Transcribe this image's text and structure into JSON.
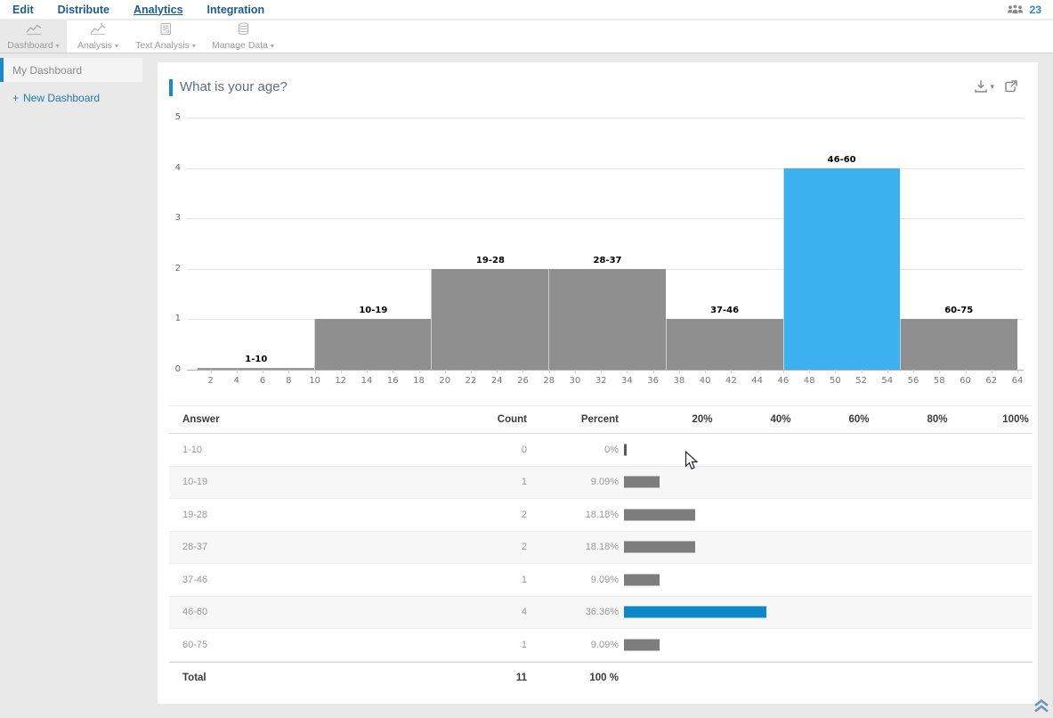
{
  "nav": {
    "items": [
      "Edit",
      "Distribute",
      "Analytics",
      "Integration"
    ],
    "active": "Analytics",
    "user_count": "23"
  },
  "toolbar": {
    "buttons": [
      {
        "label": "Dashboard",
        "icon": "dashboard-chart"
      },
      {
        "label": "Analysis",
        "icon": "analysis-chart"
      },
      {
        "label": "Text Analysis",
        "icon": "text-document"
      },
      {
        "label": "Manage Data",
        "icon": "database"
      }
    ],
    "active": "Dashboard",
    "caret": "▾"
  },
  "sidebar": {
    "active_item": "My Dashboard",
    "plus": "+",
    "new_item": "New Dashboard"
  },
  "panel": {
    "title": "What is your age?"
  },
  "chart_data": {
    "type": "histogram",
    "title": "What is your age?",
    "categories": [
      "1-10",
      "10-19",
      "19-28",
      "28-37",
      "37-46",
      "46-60",
      "60-75"
    ],
    "values": [
      0,
      1,
      2,
      2,
      1,
      4,
      1
    ],
    "highlight_index": 5,
    "ylim": [
      0,
      5
    ],
    "y_ticks": [
      0,
      1,
      2,
      3,
      4,
      5
    ],
    "x_ticks": [
      2,
      4,
      6,
      8,
      10,
      12,
      14,
      16,
      18,
      20,
      22,
      24,
      26,
      28,
      30,
      32,
      34,
      36,
      38,
      40,
      42,
      44,
      46,
      48,
      50,
      52,
      54,
      56,
      58,
      60,
      62,
      64
    ],
    "grid": true,
    "xlabel": "",
    "ylabel": ""
  },
  "table": {
    "headers": {
      "answer": "Answer",
      "count": "Count",
      "percent": "Percent"
    },
    "scale_labels": [
      "20%",
      "40%",
      "60%",
      "80%",
      "100%"
    ],
    "rows": [
      {
        "answer": "1-10",
        "count": "0",
        "percent": "0%",
        "value": 0,
        "highlight": false
      },
      {
        "answer": "10-19",
        "count": "1",
        "percent": "9.09%",
        "value": 9.09,
        "highlight": false
      },
      {
        "answer": "19-28",
        "count": "2",
        "percent": "18.18%",
        "value": 18.18,
        "highlight": false
      },
      {
        "answer": "28-37",
        "count": "2",
        "percent": "18.18%",
        "value": 18.18,
        "highlight": false
      },
      {
        "answer": "37-46",
        "count": "1",
        "percent": "9.09%",
        "value": 9.09,
        "highlight": false
      },
      {
        "answer": "46-60",
        "count": "4",
        "percent": "36.36%",
        "value": 36.36,
        "highlight": true
      },
      {
        "answer": "60-75",
        "count": "1",
        "percent": "9.09%",
        "value": 9.09,
        "highlight": false
      }
    ],
    "total": {
      "label": "Total",
      "count": "11",
      "percent": "100 %"
    }
  },
  "colors": {
    "accent": "#1e88cf",
    "chart_bar": "#8f8f8f",
    "chart_bar_highlight": "#3cb1f0",
    "chart_zero_bar": "#9a9a9a",
    "table_bar": "#7d7d7d",
    "table_bar_highlight": "#0e87c9",
    "table_zero_sliver": "#5a5a5a"
  }
}
